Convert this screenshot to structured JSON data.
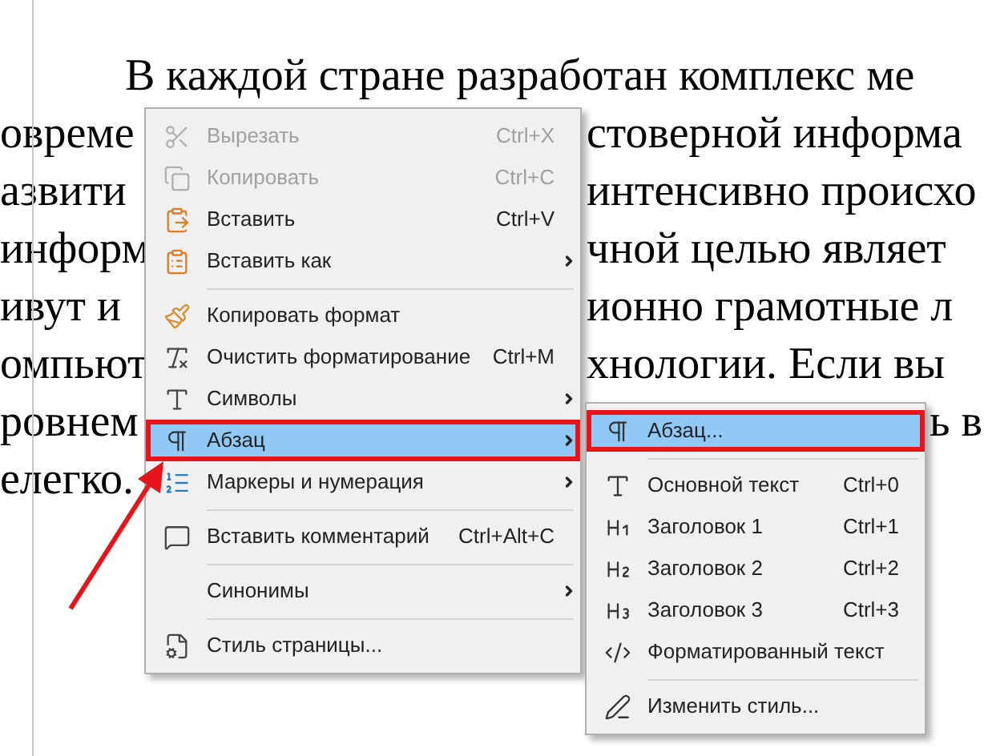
{
  "document": {
    "lines": [
      {
        "left": "В каждой стране разработан комплекс ме",
        "indent": true
      },
      {
        "left": "овреме",
        "right": "стоверной информа"
      },
      {
        "left": "азвити",
        "right": "интенсивно происхо"
      },
      {
        "left": "информ",
        "right": "чной целью являет"
      },
      {
        "left": "ивут и",
        "right": "ионно грамотные л"
      },
      {
        "left": "омпьют",
        "right": "хнологии. Если вы"
      },
      {
        "left": "ровнем",
        "far_right": "ь в"
      },
      {
        "left": "елегко."
      }
    ]
  },
  "context_menu": {
    "items": [
      {
        "kind": "item",
        "label": "Вырезать",
        "shortcut": "Ctrl+X",
        "disabled": true,
        "selected": false,
        "outlined": false,
        "submenu": false
      },
      {
        "kind": "item",
        "label": "Копировать",
        "shortcut": "Ctrl+C",
        "disabled": true,
        "selected": false,
        "outlined": false,
        "submenu": false
      },
      {
        "kind": "item",
        "label": "Вставить",
        "shortcut": "Ctrl+V",
        "disabled": false,
        "selected": false,
        "outlined": false,
        "submenu": false
      },
      {
        "kind": "item",
        "label": "Вставить как",
        "disabled": false,
        "selected": false,
        "outlined": false,
        "submenu": true
      },
      {
        "kind": "separator"
      },
      {
        "kind": "item",
        "label": "Копировать формат",
        "disabled": false,
        "selected": false,
        "outlined": false,
        "submenu": false
      },
      {
        "kind": "item",
        "label": "Очистить форматирование",
        "shortcut": "Ctrl+M",
        "disabled": false,
        "selected": false,
        "outlined": false,
        "submenu": false
      },
      {
        "kind": "item",
        "label": "Символы",
        "disabled": false,
        "selected": false,
        "outlined": false,
        "submenu": true
      },
      {
        "kind": "item",
        "label": "Абзац",
        "disabled": false,
        "selected": true,
        "outlined": true,
        "submenu": true
      },
      {
        "kind": "item",
        "label": "Маркеры и нумерация",
        "disabled": false,
        "selected": false,
        "outlined": false,
        "submenu": true
      },
      {
        "kind": "separator"
      },
      {
        "kind": "item",
        "label": "Вставить комментарий",
        "shortcut": "Ctrl+Alt+C",
        "disabled": false,
        "selected": false,
        "outlined": false,
        "submenu": false
      },
      {
        "kind": "separator"
      },
      {
        "kind": "item",
        "label": "Синонимы",
        "disabled": false,
        "selected": false,
        "outlined": false,
        "submenu": true
      },
      {
        "kind": "separator"
      },
      {
        "kind": "item",
        "label": "Стиль страницы...",
        "disabled": false,
        "selected": false,
        "outlined": false,
        "submenu": false
      }
    ]
  },
  "submenu": {
    "items": [
      {
        "kind": "item",
        "label": "Абзац...",
        "disabled": false,
        "selected": true,
        "outlined": true,
        "submenu": false
      },
      {
        "kind": "separator"
      },
      {
        "kind": "item",
        "label": "Основной текст",
        "shortcut": "Ctrl+0",
        "disabled": false,
        "selected": false,
        "outlined": false,
        "submenu": false
      },
      {
        "kind": "item",
        "label": "Заголовок 1",
        "shortcut": "Ctrl+1",
        "disabled": false,
        "selected": false,
        "outlined": false,
        "submenu": false
      },
      {
        "kind": "item",
        "label": "Заголовок 2",
        "shortcut": "Ctrl+2",
        "disabled": false,
        "selected": false,
        "outlined": false,
        "submenu": false
      },
      {
        "kind": "item",
        "label": "Заголовок 3",
        "shortcut": "Ctrl+3",
        "disabled": false,
        "selected": false,
        "outlined": false,
        "submenu": false
      },
      {
        "kind": "item",
        "label": "Форматированный текст",
        "disabled": false,
        "selected": false,
        "outlined": false,
        "submenu": false
      },
      {
        "kind": "separator"
      },
      {
        "kind": "item",
        "label": "Изменить стиль...",
        "disabled": false,
        "selected": false,
        "outlined": false,
        "submenu": false
      }
    ]
  },
  "annotation_arrow": true
}
